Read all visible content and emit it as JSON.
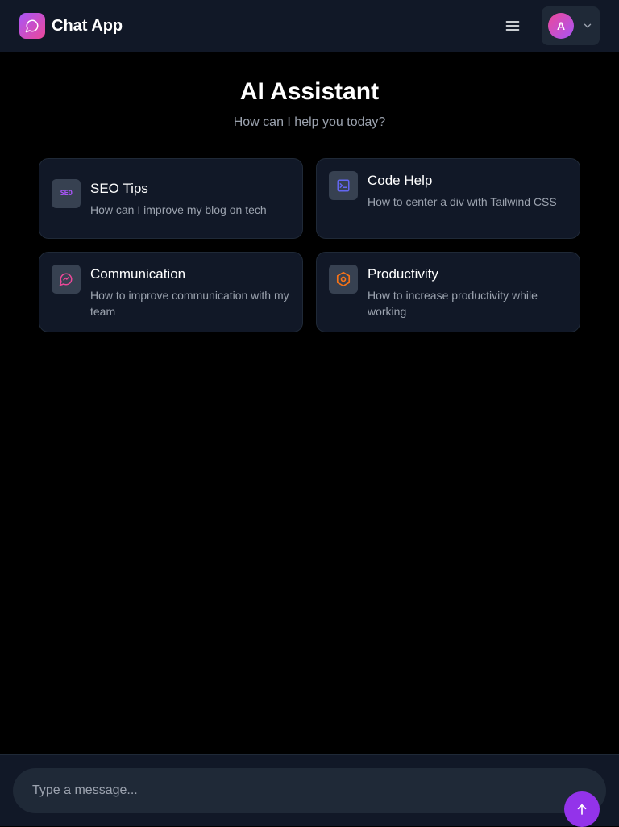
{
  "header": {
    "app_title": "Chat App",
    "logo_icon": "chat-bubble-icon",
    "menu_icon": "hamburger-icon",
    "user_initial": "A",
    "user_menu_icon": "chevron-down-icon"
  },
  "hero": {
    "title": "AI Assistant",
    "subtitle": "How can I help you today?"
  },
  "suggestions": [
    {
      "icon": "seo-icon",
      "icon_text": "SEO",
      "title": "SEO Tips",
      "description": "How can I improve my blog on tech",
      "accent": "#a855f7"
    },
    {
      "icon": "terminal-icon",
      "title": "Code Help",
      "description": "How to center a div with Tailwind CSS",
      "accent": "#6366f1"
    },
    {
      "icon": "message-icon",
      "title": "Communication",
      "description": "How to improve communication with my team",
      "accent": "#ec4899"
    },
    {
      "icon": "hexagon-icon",
      "title": "Productivity",
      "description": "How to increase productivity while working",
      "accent": "#f97316"
    }
  ],
  "composer": {
    "placeholder": "Type a message...",
    "value": "",
    "send_icon": "arrow-up-icon"
  },
  "colors": {
    "background": "#000000",
    "surface": "#111827",
    "brand_gradient_start": "#a855f7",
    "brand_gradient_end": "#ec4899",
    "send_button": "#9333ea"
  }
}
